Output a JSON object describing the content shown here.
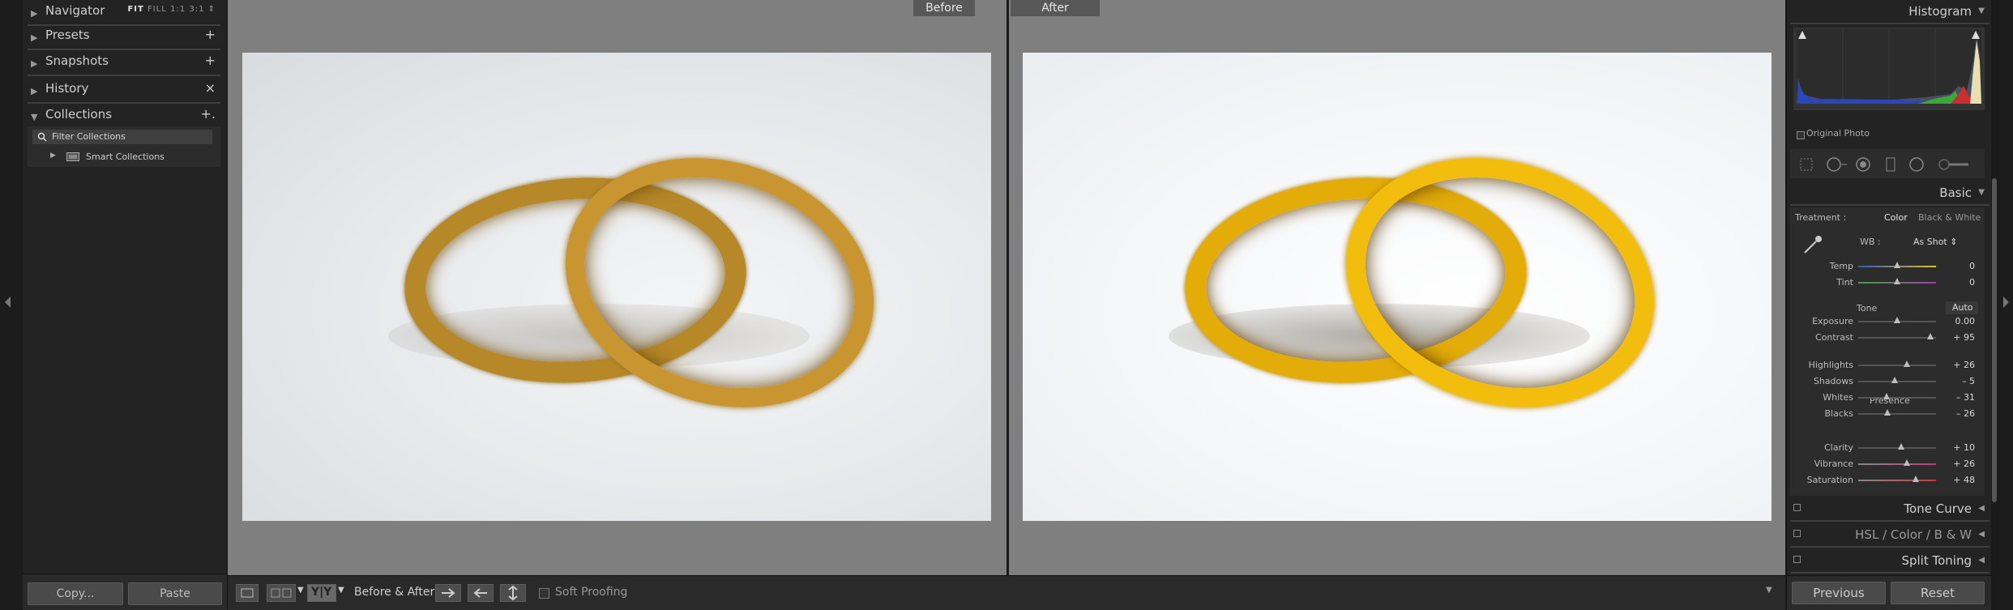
{
  "left_panel": {
    "navigator": {
      "title": "Navigator",
      "opt_fit": "FIT",
      "opt_fill": "FILL",
      "opt_1to1": "1:1",
      "opt_3to1": "3:1 ⇕"
    },
    "presets": {
      "title": "Presets",
      "action": "+"
    },
    "snapshots": {
      "title": "Snapshots",
      "action": "+"
    },
    "history": {
      "title": "History",
      "action": "×"
    },
    "collections": {
      "title": "Collections",
      "action": "+.",
      "filter_label": "Filter Collections",
      "smart_label": "Smart Collections"
    },
    "copy_button": "Copy...",
    "paste_button": "Paste"
  },
  "view": {
    "before_label": "Before",
    "after_label": "After"
  },
  "toolbar": {
    "ba_label": "Before & After :",
    "yy_label": "Y|Y",
    "soft_proofing": "Soft Proofing",
    "menu_arrow": "▼"
  },
  "right_panel": {
    "histogram": {
      "title": "Histogram",
      "original_photo": "Original Photo"
    },
    "basic": {
      "title": "Basic",
      "treatment_label": "Treatment :",
      "treatment_color": "Color",
      "treatment_bw": "Black & White",
      "wb_label": "WB :",
      "wb_value": "As Shot ⇕",
      "tone_label": "Tone",
      "auto_label": "Auto",
      "presence_label": "Presence",
      "sliders": [
        {
          "label": "Temp",
          "value": "0",
          "pos": 0.5
        },
        {
          "label": "Tint",
          "value": "0",
          "pos": 0.5
        },
        {
          "label": "Exposure",
          "value": "0.00",
          "pos": 0.5
        },
        {
          "label": "Contrast",
          "value": "+ 95",
          "pos": 0.93
        },
        {
          "label": "Highlights",
          "value": "+ 26",
          "pos": 0.63
        },
        {
          "label": "Shadows",
          "value": "– 5",
          "pos": 0.47
        },
        {
          "label": "Whites",
          "value": "– 31",
          "pos": 0.36
        },
        {
          "label": "Blacks",
          "value": "– 26",
          "pos": 0.38
        },
        {
          "label": "Clarity",
          "value": "+ 10",
          "pos": 0.55
        },
        {
          "label": "Vibrance",
          "value": "+ 26",
          "pos": 0.63
        },
        {
          "label": "Saturation",
          "value": "+ 48",
          "pos": 0.74
        }
      ]
    },
    "tone_curve": {
      "title": "Tone Curve"
    },
    "hsl": {
      "title": "HSL  /  Color  /  B & W"
    },
    "split_toning": {
      "title": "Split Toning"
    },
    "previous_button": "Previous",
    "reset_button": "Reset"
  },
  "colors": {
    "panel_bg": "#232323",
    "center_bg": "#7f7f7f",
    "gold": "#d4a017"
  }
}
